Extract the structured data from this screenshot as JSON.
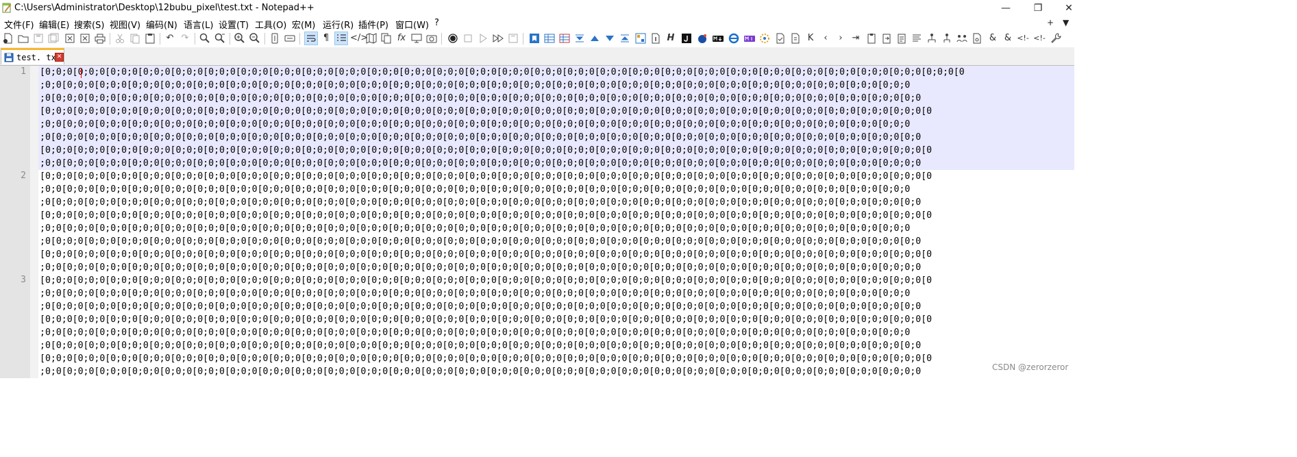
{
  "window": {
    "title": "C:\\Users\\Administrator\\Desktop\\12bubu_pixel\\test.txt - Notepad++",
    "minimize_icon": "minimize-icon",
    "maximize_icon": "restore-icon",
    "close_icon": "close-icon"
  },
  "menu": {
    "items": [
      "文件(F)",
      "编辑(E)",
      "搜索(S)",
      "视图(V)",
      "编码(N)",
      "语言(L)",
      "设置(T)",
      "工具(O)",
      "宏(M)",
      "运行(R)",
      "插件(P)",
      "窗口(W)",
      "?"
    ],
    "right": [
      "+",
      "▼"
    ]
  },
  "tab": {
    "label": "test. txt",
    "icon": "file-saved-icon",
    "close_icon": "tab-close-icon"
  },
  "editor": {
    "line_numbers": [
      "1",
      "2",
      "3"
    ],
    "line_head": "[0;0;0",
    "row_a": ";0;0[0;0;0[0;0;0[0;0;0[0;0;0[0;0;0[0;0;0[0;0;0[0;0;0[0;0;0[0;0;0[0;0;0[0;0;0[0;0;0[0;0;0[0;0;0[0;0;0[0;0;0[0;0;0[0;0;0[0;0;0[0;0;0[0;0;0[0;0;0[0;0;0[0;0;0[0;0;0",
    "row_b": ";0[0;0;0[0;0;0[0;0;0[0;0;0[0;0;0[0;0;0[0;0;0[0;0;0[0;0;0[0;0;0[0;0;0[0;0;0[0;0;0[0;0;0[0;0;0[0;0;0[0;0;0[0;0;0[0;0;0[0;0;0[0;0;0[0;0;0[0;0;0[0;0;0[0;0;0[0;0;0[0;0",
    "row_c": "[0;0;0[0;0;0[0;0;0[0;0;0[0;0;0[0;0;0[0;0;0[0;0;0[0;0;0[0;0;0[0;0;0[0;0;0[0;0;0[0;0;0[0;0;0[0;0;0[0;0;0[0;0;0[0;0;0[0;0;0[0;0;0[0;0;0[0;0;0[0;0;0[0;0;0[0;0;0[0;0;0[0",
    "row_end": ";0;0[0;0;0[0;0;0[0;0;0[0;0;0[0;0;0[0;0;0[0;0;0[0;0;0[0;0;0[0;0;0[0;0;0[0;0;0[0;0;0[0;0;0[0;0;0[0;0;0[0;0;0[0;0;0[0;0;0[0;0;0[0;0;0[0;0;0[0;0;0[0;0;0[0;0;0[0;0;0;0"
  },
  "watermark": "CSDN @zerorzeror",
  "colors": {
    "current_line": "#e8e8ff",
    "gutter": "#e4e4e4",
    "tab_accent": "#f7b72f",
    "caret": "#ff0000"
  }
}
